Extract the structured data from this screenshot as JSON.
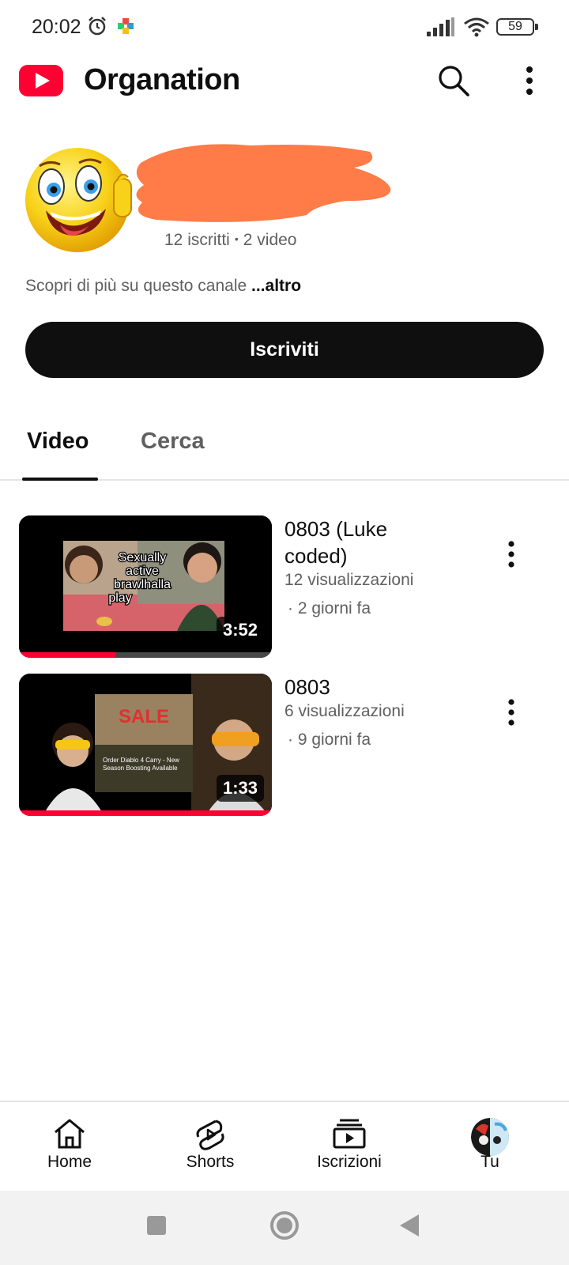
{
  "status_bar": {
    "time": "20:02",
    "battery": "59",
    "icons": [
      "alarm-icon",
      "app-notification-icon",
      "signal-icon",
      "wifi-icon",
      "battery-icon"
    ]
  },
  "header": {
    "title": "Organation",
    "icons": [
      "youtube-logo-icon",
      "search-icon",
      "more-vert-icon"
    ],
    "brand_color": "#ff0033"
  },
  "channel": {
    "subscribers": "12 iscritti",
    "separator": "•",
    "video_count": "2 video",
    "description": "Scopri di più su questo canale",
    "more_link": "...altro",
    "subscribe_label": "Iscriviti",
    "redaction_color": "#ff7b47"
  },
  "tabs": [
    {
      "label": "Video",
      "selected": true
    },
    {
      "label": "Cerca",
      "selected": false
    }
  ],
  "videos": [
    {
      "title": "0803 (Luke coded)",
      "views": "12 visualizzazioni",
      "age": "· 2 giorni fa",
      "duration": "3:52",
      "watched_fraction": 0.38,
      "thumbnail_caption": [
        "Sexually",
        "active",
        "brawlhalla",
        "play"
      ]
    },
    {
      "title": "0803",
      "views": "6 visualizzazioni",
      "age": "· 9 giorni fa",
      "duration": "1:33",
      "watched_fraction": 1.0,
      "thumbnail_caption": [
        "SALE",
        "Order Diablo 4 Carry - New",
        "Season Boosting Available"
      ]
    }
  ],
  "bottom_nav": [
    {
      "label": "Home",
      "icon": "home-icon"
    },
    {
      "label": "Shorts",
      "icon": "shorts-icon"
    },
    {
      "label": "Iscrizioni",
      "icon": "subscriptions-icon"
    },
    {
      "label": "Tu",
      "icon": "profile-avatar"
    }
  ],
  "system_nav": [
    "recents-button",
    "home-button",
    "back-button"
  ]
}
